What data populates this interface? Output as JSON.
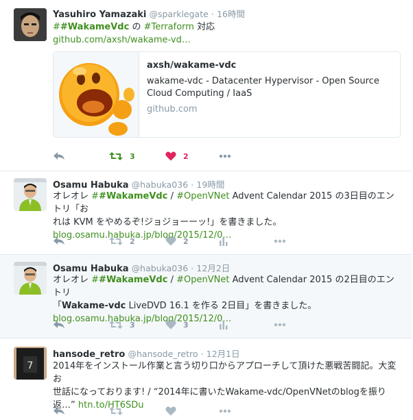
{
  "colors": {
    "accent": "#3f8f1e",
    "like": "#e0245e",
    "muted": "#8899a6",
    "text": "#292f33"
  },
  "tweets": [
    {
      "name": "Yasuhiro Yamazaki",
      "handle": "@sparklegate",
      "sep": "·",
      "time": "16時間",
      "text": {
        "tag1": "#WakameVdc",
        "mid1": " の ",
        "tag2": "#Terraform",
        "mid2": " 対応",
        "link": "github.com/axsh/wakame-vd…"
      },
      "card": {
        "title": "axsh/wakame-vdc",
        "description": "wakame-vdc - Datacenter Hypervisor - Open Source Cloud Computing / IaaS",
        "domain": "github.com"
      },
      "actions": {
        "retweets": "3",
        "likes": "2",
        "retweeted": true,
        "liked": true
      }
    },
    {
      "name": "Osamu Habuka",
      "handle": "@habuka036",
      "sep": "·",
      "time": "19時間",
      "text": {
        "line1": "オレオレ ",
        "tag1": "#WakameVdc",
        "slash": " / ",
        "tag2": "#OpenVNet",
        "rest1": " Advent Calendar 2015 の3日目のエントリ「お",
        "line2": "れは KVM をやめるぞ!ジョジョーーッ!」を書きました。",
        "link": "blog.osamu.habuka.jp/blog/2015/12/0…"
      },
      "actions": {
        "retweets": "2",
        "likes": "2"
      }
    },
    {
      "name": "Osamu Habuka",
      "handle": "@habuka036",
      "sep": "·",
      "time": "12月2日",
      "text": {
        "line1": "オレオレ ",
        "tag1": "#WakameVdc",
        "slash": " / ",
        "tag2": "#OpenVNet",
        "rest1": " Advent Calendar 2015 の2日目のエントリ",
        "line2a": "「",
        "bold2": "Wakame-vdc",
        "line2b": " LiveDVD 16.1 を作る 2日目」を書きました。",
        "link": "blog.osamu.habuka.jp/blog/2015/12/0…"
      },
      "actions": {
        "retweets": "3",
        "likes": "3"
      }
    },
    {
      "name": "hansode_retro",
      "handle": "@hansode_retro",
      "sep": "·",
      "time": "12月1日",
      "text": {
        "line1": "2014年をインストール作業と言う切り口からアプローチして頂けた悪戦苦闘記。大変お",
        "line2": "世話になっております! / “2014年に書いたWakame-vdc/OpenVNetのblogを振り",
        "line3": "返…” ",
        "link": "htn.to/HT6SDu"
      },
      "actions": {}
    }
  ]
}
